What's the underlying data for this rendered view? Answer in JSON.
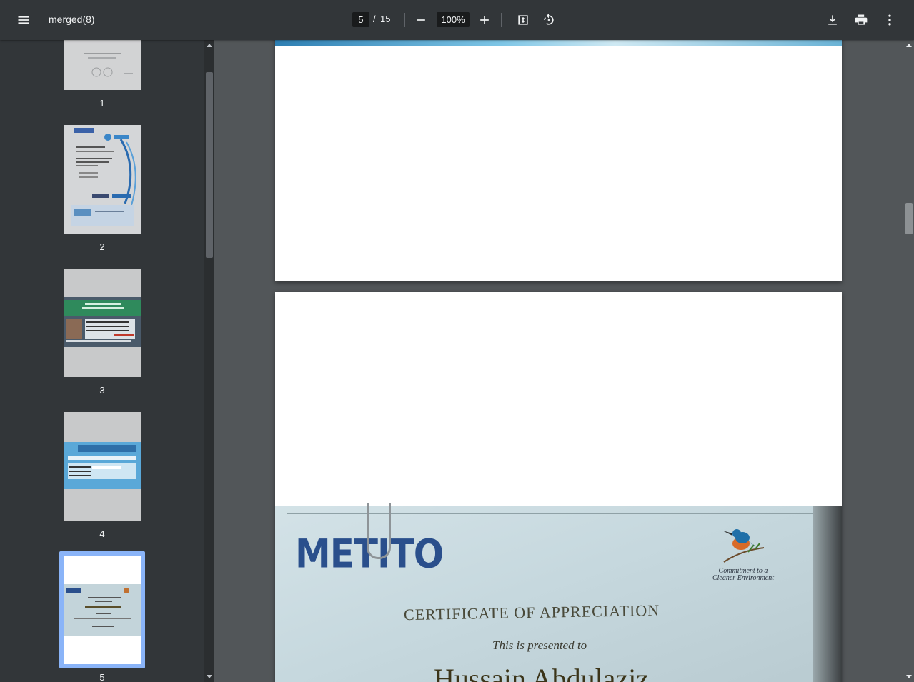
{
  "toolbar": {
    "menu_icon": "hamburger-menu-icon",
    "title": "merged(8)",
    "current_page": "5",
    "separator": "/",
    "total_pages": "15",
    "zoom": "100%",
    "zoom_out_icon": "minus-icon",
    "zoom_in_icon": "plus-icon",
    "fit_icon": "fit-to-page-icon",
    "rotate_icon": "rotate-counterclockwise-icon",
    "download_icon": "download-icon",
    "print_icon": "print-icon",
    "more_icon": "more-vertical-icon"
  },
  "sidebar": {
    "thumbnails": [
      {
        "number": "1"
      },
      {
        "number": "2"
      },
      {
        "number": "3"
      },
      {
        "number": "4"
      },
      {
        "number": "5",
        "selected": true
      }
    ]
  },
  "document": {
    "certificate": {
      "logo": "METITO",
      "tagline_line1": "Commitment to a",
      "tagline_line2": "Cleaner Environment",
      "title": "CERTIFICATE OF APPRECIATION",
      "presented": "This is presented to",
      "name": "Hussain Abdulaziz"
    }
  },
  "colors": {
    "toolbar_bg": "#323639",
    "viewer_bg": "#525659",
    "selection": "#8ab4f8"
  }
}
